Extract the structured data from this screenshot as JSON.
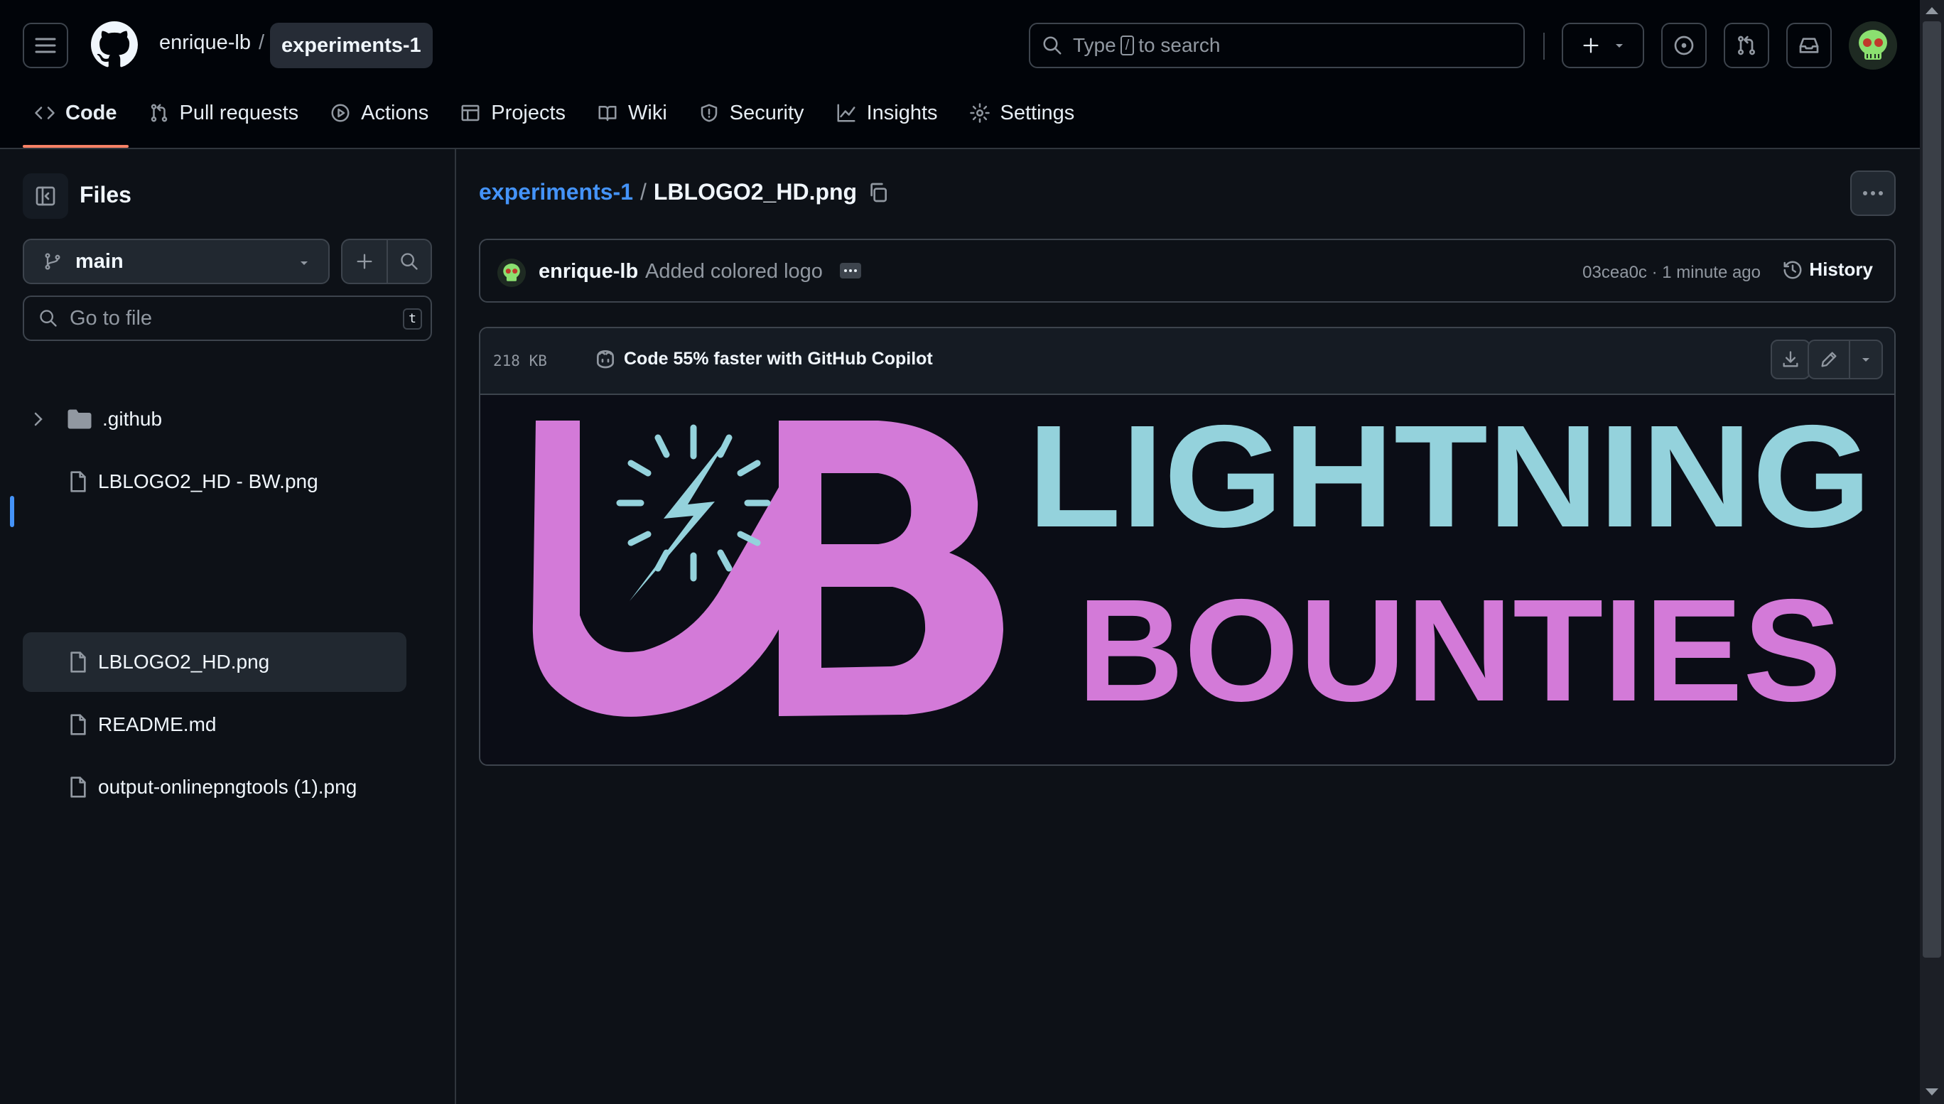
{
  "header": {
    "owner": "enrique-lb",
    "separator": "/",
    "repo": "experiments-1",
    "search_prefix": "Type",
    "search_key": "/",
    "search_suffix": "to search"
  },
  "nav": {
    "tabs": [
      {
        "label": "Code",
        "icon": "code-icon",
        "active": true
      },
      {
        "label": "Pull requests",
        "icon": "pull-request-icon"
      },
      {
        "label": "Actions",
        "icon": "play-icon"
      },
      {
        "label": "Projects",
        "icon": "table-icon"
      },
      {
        "label": "Wiki",
        "icon": "book-icon"
      },
      {
        "label": "Security",
        "icon": "shield-icon"
      },
      {
        "label": "Insights",
        "icon": "graph-icon"
      },
      {
        "label": "Settings",
        "icon": "gear-icon"
      }
    ]
  },
  "sidebar": {
    "title": "Files",
    "branch": "main",
    "goto_placeholder": "Go to file",
    "goto_shortcut": "t",
    "tree": [
      {
        "name": ".github",
        "type": "folder"
      },
      {
        "name": "LBLOGO2_HD - BW.png",
        "type": "file"
      },
      {
        "name": "LBLOGO2_HD.png",
        "type": "file",
        "selected": true
      },
      {
        "name": "README.md",
        "type": "file"
      },
      {
        "name": "output-onlinepngtools (1).png",
        "type": "file"
      }
    ]
  },
  "main": {
    "breadcrumb_repo": "experiments-1",
    "breadcrumb_sep": "/",
    "breadcrumb_file": "LBLOGO2_HD.png",
    "commit": {
      "author": "enrique-lb",
      "message": "Added colored logo",
      "meta": "03cea0c · 1 minute ago",
      "history_label": "History"
    },
    "file": {
      "size": "218 KB",
      "copilot_promo": "Code 55% faster with GitHub Copilot"
    },
    "image_text": {
      "line1": "LIGHTNING",
      "line2": "BOUNTIES"
    }
  },
  "colors": {
    "accent_link": "#4493f8",
    "active_tab_underline": "#f78166",
    "logo_pink": "#d37ad8",
    "logo_cyan": "#94d2dc"
  }
}
